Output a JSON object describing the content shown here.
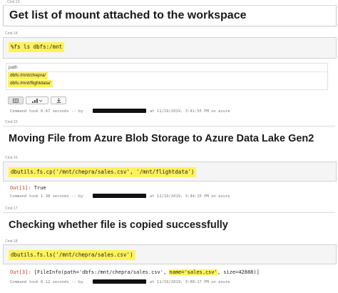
{
  "top_cmd_label": "Cmd 13",
  "sections": [
    {
      "title": "Get list of mount attached to the workspace"
    },
    {
      "title": "Moving File from Azure Blob Storage to Azure Data Lake Gen2"
    },
    {
      "title": "Checking whether file is copied successfully"
    }
  ],
  "cells": {
    "c14": {
      "label": "Cmd 14",
      "code": "%fs ls dbfs:/mnt",
      "table_header": "path",
      "rows": [
        "dbfs:/mnt/chepra/",
        "dbfs:/mnt/flightdata/"
      ],
      "footer_pre": "Command took 0.47 seconds -- by",
      "footer_post": "at 11/19/2019, 3:41:55 PM on azure"
    },
    "c15": {
      "label": "Cmd 15"
    },
    "c16": {
      "label": "Cmd 16",
      "code": "dbutils.fs.cp('/mnt/chepra/sales.csv', '/mnt/flightdata')",
      "out_prefix": "Out[1]:",
      "out_value": " True",
      "footer_pre": "Command took 1.38 seconds -- by",
      "footer_post": "at 11/19/2019, 3:44:15 PM on azure"
    },
    "c17": {
      "label": "Cmd 17"
    },
    "c18": {
      "label": "Cmd 18",
      "code": "dbutils.fs.ls('/mnt/chepra/sales.csv')",
      "out_prefix": "Out[3]:",
      "out_a": " [FileInfo(path='dbfs:/mnt/chepra/sales.csv', ",
      "out_b": "name='sales.csv'",
      "out_c": ", size=42888)]",
      "footer_pre": "Command took 0.12 seconds -- by",
      "footer_post": "at 11/19/2019, 3:48:17 PM on azure"
    }
  },
  "toolbar": {
    "table_icon": "table-icon",
    "chart_icon": "bar-chart-icon",
    "download_icon": "download-icon"
  },
  "colors": {
    "highlight": "#fff25c",
    "out_prefix": "#c23b22",
    "redaction": "#111111"
  }
}
